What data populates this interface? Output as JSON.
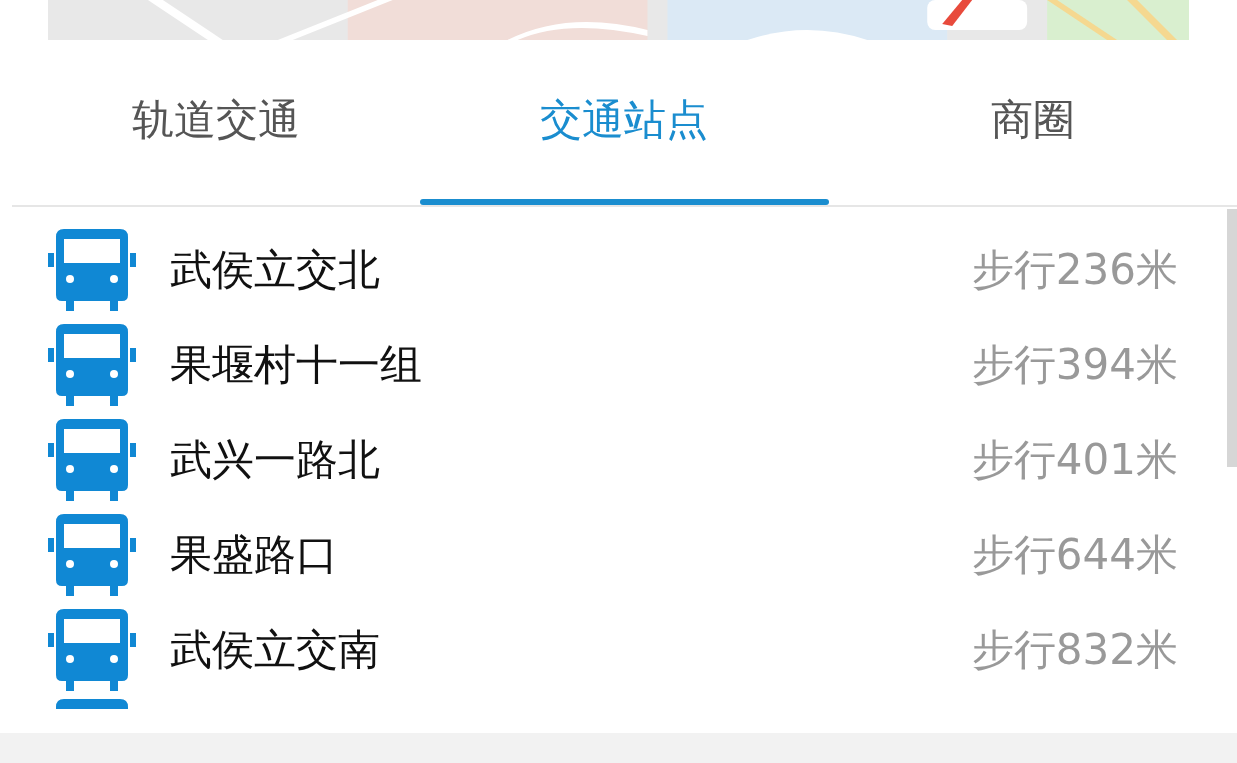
{
  "tabs": [
    {
      "label": "轨道交通",
      "selected": false
    },
    {
      "label": "交通站点",
      "selected": true
    },
    {
      "label": "商圈",
      "selected": false
    }
  ],
  "stations": [
    {
      "name": "武侯立交北",
      "distance": "步行236米"
    },
    {
      "name": "果堰村十一组",
      "distance": "步行394米"
    },
    {
      "name": "武兴一路北",
      "distance": "步行401米"
    },
    {
      "name": "果盛路口",
      "distance": "步行644米"
    },
    {
      "name": "武侯立交南",
      "distance": "步行832米"
    }
  ]
}
